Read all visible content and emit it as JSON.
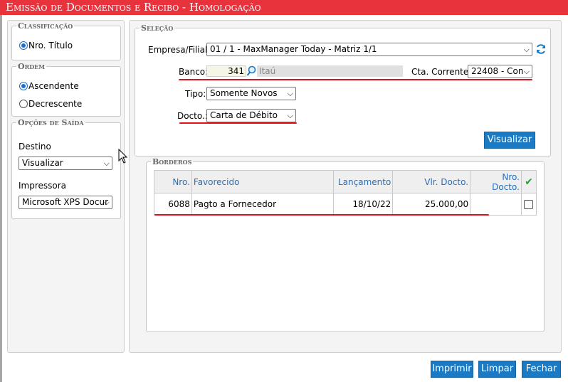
{
  "window": {
    "title": "Emissão de Documentos e Recibo  - Homologação"
  },
  "left": {
    "classificacao": {
      "legend": "Classificação",
      "options": [
        {
          "label": "Nro. Título",
          "selected": true
        }
      ]
    },
    "ordem": {
      "legend": "Ordem",
      "options": [
        {
          "label": "Ascendente",
          "selected": true
        },
        {
          "label": "Decrescente",
          "selected": false
        }
      ]
    },
    "saida": {
      "legend": "Opções de Saída",
      "destino_label": "Destino",
      "destino_value": "Visualizar",
      "impressora_label": "Impressora",
      "impressora_value": "Microsoft XPS Docur"
    }
  },
  "selecao": {
    "legend": "Seleção",
    "empresa_label": "Empresa/Filial:",
    "empresa_value": "01 / 1 - MaxManager Today - Matriz 1/1",
    "banco_label": "Banco:",
    "banco_code": "341",
    "banco_name": "Itaú",
    "cta_label": "Cta. Corrente:",
    "cta_value": "22408 - Con",
    "tipo_label": "Tipo:",
    "tipo_value": "Somente Novos",
    "docto_label": "Docto.:",
    "docto_value": "Carta de Débito",
    "visualizar_label": "Visualizar"
  },
  "borderos": {
    "legend": "Borderos",
    "columns": [
      "Nro.",
      "Favorecido",
      "Lançamento",
      "Vlr. Docto.",
      "Nro. Docto.",
      "✔"
    ],
    "rows": [
      {
        "nro": "6088",
        "favorecido": "Pagto a Fornecedor",
        "lancamento": "18/10/22",
        "vlr": "25.000,00",
        "nro_docto": "",
        "checked": false
      }
    ]
  },
  "footer": {
    "imprimir": "Imprimir",
    "limpar": "Limpar",
    "fechar": "Fechar"
  },
  "colors": {
    "title_bar": "#e8333d",
    "button": "#1a7bc4",
    "accent_line": "#d8141c",
    "header_text": "#2a6fb8",
    "check": "#2e9b3a"
  }
}
